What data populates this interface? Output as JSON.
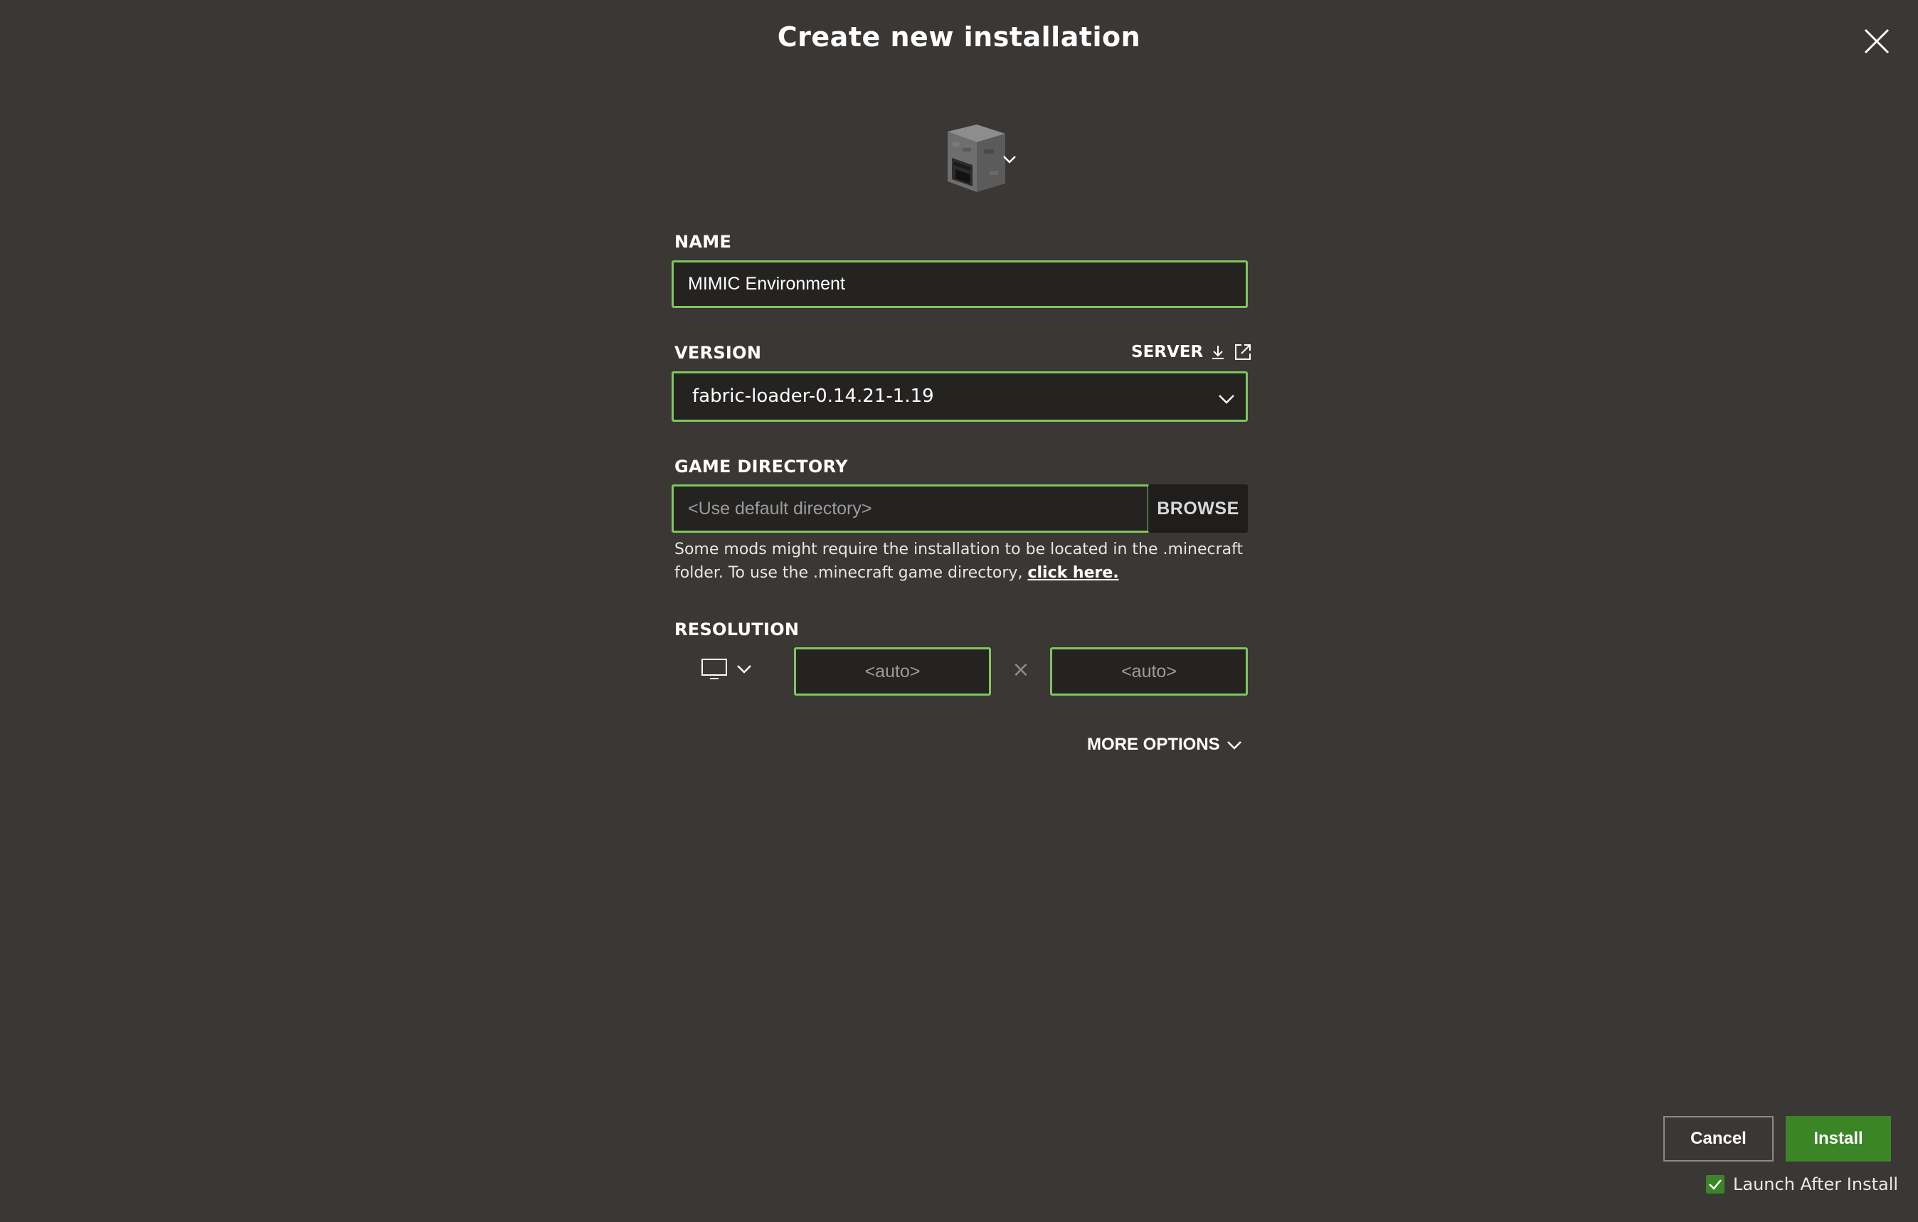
{
  "dialog": {
    "title": "Create new installation"
  },
  "icon_picker": {
    "icon": "furnace-block-icon",
    "chevron": "chevron-down-icon"
  },
  "name": {
    "label": "NAME",
    "value": "MIMIC Environment"
  },
  "version": {
    "label": "VERSION",
    "server_label": "SERVER",
    "selected": "fabric-loader-0.14.21-1.19"
  },
  "game_directory": {
    "label": "GAME DIRECTORY",
    "placeholder": "<Use default directory>",
    "browse_label": "BROWSE",
    "hint_text": "Some mods might require the installation to be located in the .minecraft folder. To use the .minecraft game directory,",
    "hint_link": "click here."
  },
  "resolution": {
    "label": "RESOLUTION",
    "width_placeholder": "<auto>",
    "height_placeholder": "<auto>",
    "separator": "×"
  },
  "more_options": {
    "label": "MORE OPTIONS"
  },
  "footer": {
    "cancel_label": "Cancel",
    "install_label": "Install",
    "launch_after_install_label": "Launch After Install",
    "launch_after_install_checked": true
  },
  "colors": {
    "background": "#3a3735",
    "accent_border": "#7fc65c",
    "install_button": "#3c8527",
    "field_bg": "#242322"
  }
}
